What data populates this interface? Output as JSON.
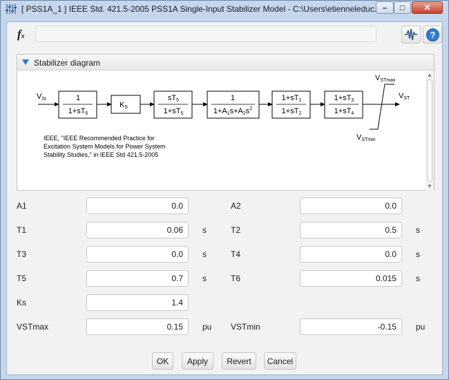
{
  "window": {
    "title": "[ PSS1A_1 ]  IEEE Std. 421.5-2005 PSS1A Single-Input Stabilizer Model - C:\\Users\\etienneleduc...",
    "minimize_label": "–",
    "maximize_label": "□",
    "close_label": "✕",
    "app_icon": "mixer-sliders-icon"
  },
  "toolbar": {
    "fx_letter": "f",
    "fx_sub": "x",
    "formula_value": "",
    "wave_icon": "signal-wave-icon",
    "help_label": "?"
  },
  "panel": {
    "title": "Stabilizer diagram",
    "expand_icon": "triangle-down-icon"
  },
  "diagram": {
    "input_label": "V",
    "input_sub": "SI",
    "output_label": "V",
    "output_sub": "ST",
    "max_label": "V",
    "max_sub": "STmax",
    "min_label": "V",
    "min_sub": "STmin",
    "block1_num": "1",
    "block1_den": "1+sT",
    "block1_den_sub": "6",
    "block2": "K",
    "block2_sub": "S",
    "block3_num": "sT",
    "block3_num_sub": "5",
    "block3_den": "1+sT",
    "block3_den_sub": "5",
    "block4_num": "1",
    "block4_den_a": "1+A",
    "block4_den_a_sub": "1",
    "block4_den_b": "s+A",
    "block4_den_b_sub": "2",
    "block4_den_c": "s",
    "block4_den_c_sup": "2",
    "block5_num": "1+sT",
    "block5_num_sub": "1",
    "block5_den": "1+sT",
    "block5_den_sub": "2",
    "block6_num": "1+sT",
    "block6_num_sub": "3",
    "block6_den": "1+sT",
    "block6_den_sub": "4",
    "reference": [
      "IEEE, \"IEEE Recommended Practice for",
      "Excitation System Models for Power System",
      "Stability Studies,\" in IEEE Std 421.5-2005"
    ]
  },
  "fields": {
    "a1": {
      "label": "A1",
      "value": "0.0",
      "unit": ""
    },
    "a2": {
      "label": "A2",
      "value": "0.0",
      "unit": ""
    },
    "t1": {
      "label": "T1",
      "value": "0.06",
      "unit": "s"
    },
    "t2": {
      "label": "T2",
      "value": "0.5",
      "unit": "s"
    },
    "t3": {
      "label": "T3",
      "value": "0.0",
      "unit": "s"
    },
    "t4": {
      "label": "T4",
      "value": "0.0",
      "unit": "s"
    },
    "t5": {
      "label": "T5",
      "value": "0.7",
      "unit": "s"
    },
    "t6": {
      "label": "T6",
      "value": "0.015",
      "unit": "s"
    },
    "ks": {
      "label": "Ks",
      "value": "1.4",
      "unit": ""
    },
    "vstmax": {
      "label": "VSTmax",
      "value": "0.15",
      "unit": "pu"
    },
    "vstmin": {
      "label": "VSTmin",
      "value": "-0.15",
      "unit": "pu"
    }
  },
  "buttons": {
    "ok": "OK",
    "apply": "Apply",
    "revert": "Revert",
    "cancel": "Cancel"
  }
}
